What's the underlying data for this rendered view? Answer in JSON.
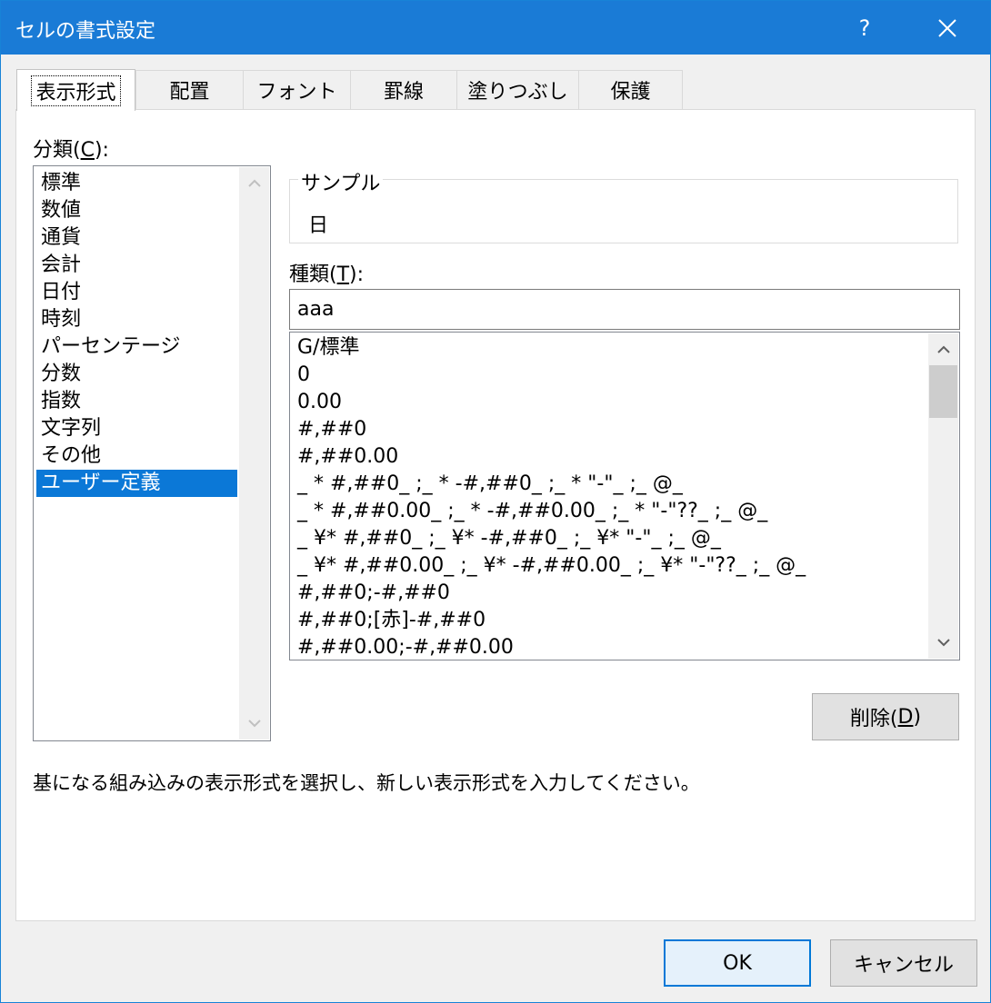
{
  "window": {
    "title": "セルの書式設定",
    "help_label": "?"
  },
  "tabs": [
    {
      "label": "表示形式",
      "active": true
    },
    {
      "label": "配置"
    },
    {
      "label": "フォント"
    },
    {
      "label": "罫線"
    },
    {
      "label": "塗りつぶし"
    },
    {
      "label": "保護"
    }
  ],
  "category": {
    "label_prefix": "分類(",
    "label_key": "C",
    "label_suffix": "):",
    "items": [
      "標準",
      "数値",
      "通貨",
      "会計",
      "日付",
      "時刻",
      "パーセンテージ",
      "分数",
      "指数",
      "文字列",
      "その他",
      "ユーザー定義"
    ],
    "selected": "ユーザー定義"
  },
  "sample": {
    "caption": "サンプル",
    "value": "日"
  },
  "type": {
    "label_prefix": "種類(",
    "label_key": "T",
    "label_suffix": "):",
    "value": "aaa",
    "formats": [
      "G/標準",
      "0",
      "0.00",
      "#,##0",
      "#,##0.00",
      "_ * #,##0_ ;_ * -#,##0_ ;_ * \"-\"_ ;_ @_",
      "_ * #,##0.00_ ;_ * -#,##0.00_ ;_ * \"-\"??_ ;_ @_",
      "_ ¥* #,##0_ ;_ ¥* -#,##0_ ;_ ¥* \"-\"_ ;_ @_",
      "_ ¥* #,##0.00_ ;_ ¥* -#,##0.00_ ;_ ¥* \"-\"??_ ;_ @_",
      "#,##0;-#,##0",
      "#,##0;[赤]-#,##0",
      "#,##0.00;-#,##0.00"
    ]
  },
  "delete_button": {
    "label_prefix": "削除(",
    "label_key": "D",
    "label_suffix": ")"
  },
  "description": "基になる組み込みの表示形式を選択し、新しい表示形式を入力してください。",
  "footer": {
    "ok_label": "OK",
    "cancel_label": "キャンセル"
  },
  "colors": {
    "titlebar": "#1a7bd6",
    "selection": "#0b78d7"
  }
}
